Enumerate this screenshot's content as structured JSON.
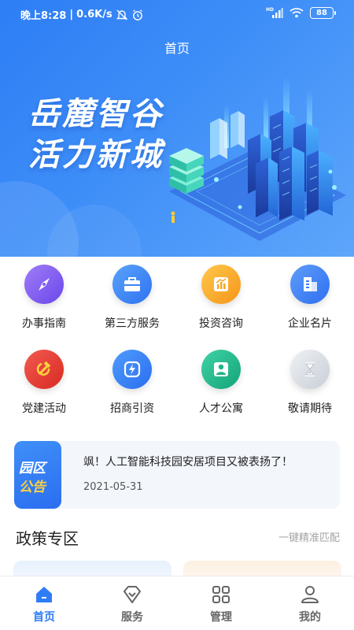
{
  "status_bar": {
    "time": "晚上8:28",
    "separator": "|",
    "speed": "0.6K/s",
    "network": "HD",
    "battery": "88"
  },
  "header": {
    "title": "首页"
  },
  "banner": {
    "line1": "岳麓智谷",
    "line2": "活力新城"
  },
  "services": [
    {
      "label": "办事指南",
      "icon": "compass-icon",
      "color": "#7b5cf0"
    },
    {
      "label": "第三方服务",
      "icon": "briefcase-icon",
      "color": "#3b86f6"
    },
    {
      "label": "投资咨询",
      "icon": "investment-chart-icon",
      "color": "#f7a51f"
    },
    {
      "label": "企业名片",
      "icon": "building-icon",
      "color": "#3d7ff5"
    },
    {
      "label": "党建活动",
      "icon": "hammer-sickle-icon",
      "color": "#e8322c"
    },
    {
      "label": "招商引资",
      "icon": "lightning-icon",
      "color": "#3a8bf7"
    },
    {
      "label": "人才公寓",
      "icon": "person-icon",
      "color": "#1fb487"
    },
    {
      "label": "敬请期待",
      "icon": "hourglass-icon",
      "color": "#c9ced6"
    }
  ],
  "notice": {
    "badge_line1": "园区",
    "badge_line2": "公告",
    "title": "飒！人工智能科技园安居项目又被表扬了！",
    "date": "2021-05-31"
  },
  "policy": {
    "title": "政策专区",
    "link": "一键精准匹配"
  },
  "tabbar": {
    "items": [
      {
        "label": "首页",
        "icon": "home-icon",
        "active": true
      },
      {
        "label": "服务",
        "icon": "diamond-icon",
        "active": false
      },
      {
        "label": "管理",
        "icon": "grid-icon",
        "active": false
      },
      {
        "label": "我的",
        "icon": "user-icon",
        "active": false
      }
    ]
  }
}
